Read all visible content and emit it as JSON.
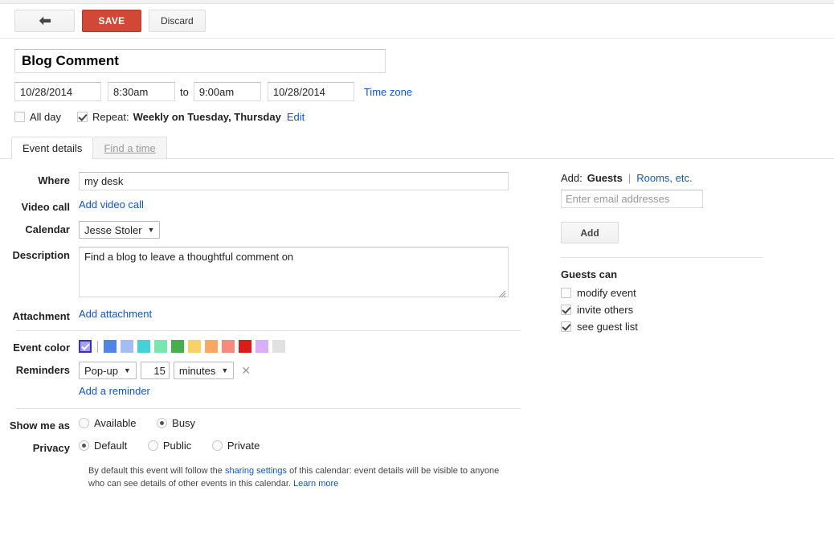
{
  "toolbar": {
    "back_icon": "back-arrow-icon",
    "save_label": "SAVE",
    "discard_label": "Discard",
    "save_color": "#d14836"
  },
  "event": {
    "title": "Blog Comment",
    "start_date": "10/28/2014",
    "start_time": "8:30am",
    "to_label": "to",
    "end_time": "9:00am",
    "end_date": "10/28/2014",
    "timezone_link": "Time zone",
    "all_day_label": "All day",
    "all_day_checked": false,
    "repeat_label": "Repeat:",
    "repeat_checked": true,
    "repeat_value": "Weekly on Tuesday, Thursday",
    "repeat_edit": "Edit"
  },
  "tabs": [
    {
      "label": "Event details",
      "active": true
    },
    {
      "label": "Find a time",
      "active": false
    }
  ],
  "details": {
    "where_label": "Where",
    "where_value": "my desk",
    "video_label": "Video call",
    "video_link": "Add video call",
    "calendar_label": "Calendar",
    "calendar_value": "Jesse Stoler",
    "description_label": "Description",
    "description_value": "Find a blog to leave a thoughtful comment on",
    "attachment_label": "Attachment",
    "attachment_link": "Add attachment",
    "color_label": "Event color",
    "reminders_label": "Reminders",
    "reminder_type": "Pop-up",
    "reminder_number": "15",
    "reminder_unit": "minutes",
    "reminder_remove_icon": "close-x-icon",
    "add_reminder_link": "Add a reminder",
    "show_me_as_label": "Show me as",
    "privacy_label": "Privacy"
  },
  "event_colors": {
    "selected": "#a4a0f5",
    "selected_border": "#3b2fbe",
    "swatches": [
      "#4e86e8",
      "#a4bdf8",
      "#41d3d8",
      "#74e8ae",
      "#43b14b",
      "#fad165",
      "#fba75e",
      "#fa8a7c",
      "#d91e18",
      "#dbadff",
      "#e1e1e1"
    ]
  },
  "show_me_as": {
    "options": [
      {
        "label": "Available",
        "selected": false
      },
      {
        "label": "Busy",
        "selected": true
      }
    ]
  },
  "privacy": {
    "options": [
      {
        "label": "Default",
        "selected": true
      },
      {
        "label": "Public",
        "selected": false
      },
      {
        "label": "Private",
        "selected": false
      }
    ]
  },
  "note": {
    "part1": "By default this event will follow the ",
    "link1": "sharing settings",
    "part2": " of this calendar: event details will be visible to anyone who can see details of other events in this calendar. ",
    "link2": "Learn more"
  },
  "guests": {
    "add_label": "Add:",
    "guests_tab": "Guests",
    "separator": "|",
    "rooms_link": "Rooms, etc.",
    "email_placeholder": "Enter email addresses",
    "email_value": "",
    "add_button": "Add",
    "guests_can_label": "Guests can",
    "permissions": [
      {
        "label": "modify event",
        "checked": false
      },
      {
        "label": "invite others",
        "checked": true
      },
      {
        "label": "see guest list",
        "checked": true
      }
    ]
  }
}
